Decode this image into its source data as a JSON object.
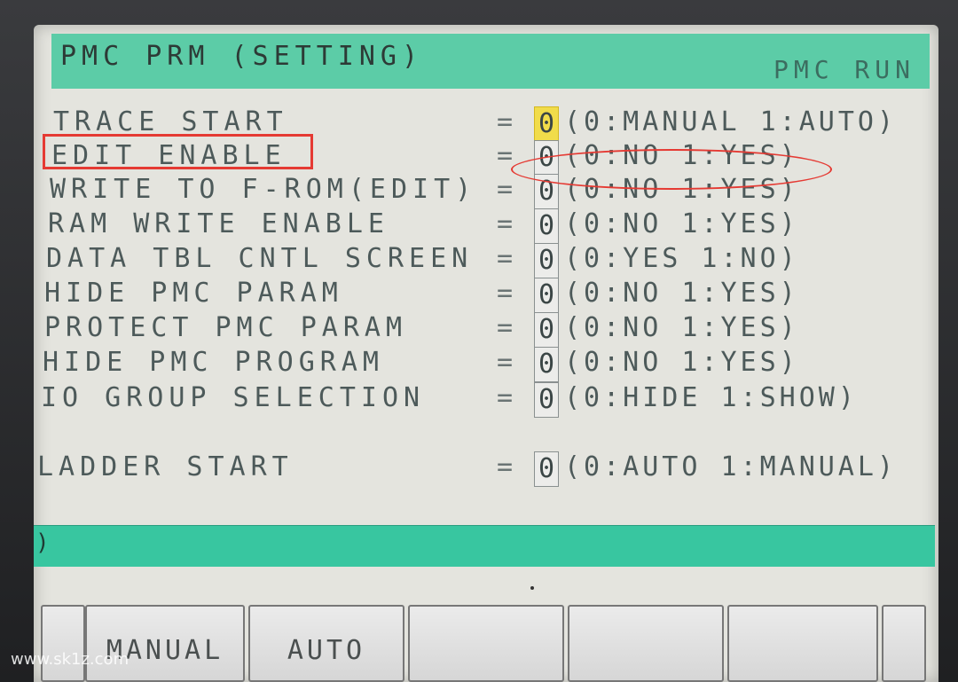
{
  "title_bar": {
    "left": "PMC PRM (SETTING)",
    "right": "PMC RUN"
  },
  "params": [
    {
      "label": "TRACE START",
      "eq": "=",
      "value": "0",
      "options": "(0:MANUAL 1:AUTO)"
    },
    {
      "label": "EDIT ENABLE",
      "eq": "=",
      "value": "0",
      "options": "(0:NO 1:YES)"
    },
    {
      "label": "WRITE TO F-ROM(EDIT)",
      "eq": "=",
      "value": "0",
      "options": "(0:NO 1:YES)"
    },
    {
      "label": "RAM WRITE ENABLE",
      "eq": "=",
      "value": "0",
      "options": "(0:NO 1:YES)"
    },
    {
      "label": "DATA TBL CNTL SCREEN",
      "eq": "=",
      "value": "0",
      "options": "(0:YES 1:NO)"
    },
    {
      "label": "HIDE PMC PARAM",
      "eq": "=",
      "value": "0",
      "options": "(0:NO 1:YES)"
    },
    {
      "label": "PROTECT PMC PARAM",
      "eq": "=",
      "value": "0",
      "options": "(0:NO 1:YES)"
    },
    {
      "label": "HIDE PMC PROGRAM",
      "eq": "=",
      "value": "0",
      "options": "(0:NO 1:YES)"
    },
    {
      "label": "IO GROUP SELECTION",
      "eq": "=",
      "value": "0",
      "options": "(0:HIDE 1:SHOW)"
    },
    {
      "label": "LADDER START",
      "eq": "=",
      "value": "0",
      "options": "(0:AUTO 1:MANUAL)"
    }
  ],
  "input_line": {
    "prompt": ")"
  },
  "softkeys": [
    {
      "label": ""
    },
    {
      "label": "MANUAL"
    },
    {
      "label": "AUTO"
    },
    {
      "label": ""
    },
    {
      "label": ""
    },
    {
      "label": ""
    },
    {
      "label": ""
    }
  ],
  "watermark": "www.sk1z.com",
  "colors": {
    "title_bar": "#5ccca7",
    "cursor": "#f1dc4a",
    "highlight": "#e53a33",
    "input_bar": "#38c6a0"
  }
}
